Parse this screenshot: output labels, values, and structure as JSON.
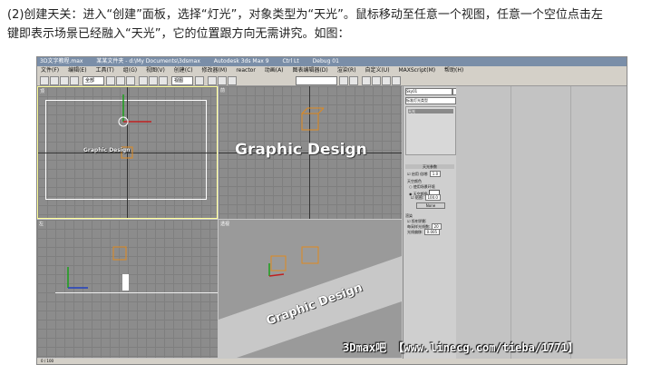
{
  "instruction": {
    "line1": "(2)创建天关：进入“创建”面板，选择“灯光”，对象类型为“天光”。鼠标移动至任意一个视图，任意一个空位点击左",
    "line2": "键即表示场景已经融入“天光”，它的位置跟方向无需讲究。如图："
  },
  "screenshot": {
    "titlebar": [
      "3D文字教程.max",
      "某某文件夹 - d:\\My Documents\\3dsmax",
      "Autodesk 3ds Max 9",
      "Ctrl Lt",
      "Debug 01"
    ],
    "menu": [
      "文件(F)",
      "编辑(E)",
      "工具(T)",
      "组(G)",
      "视图(V)",
      "创建(C)",
      "修改器(M)",
      "reactor",
      "动画(A)",
      "图表编辑器(D)",
      "渲染(R)",
      "自定义(U)",
      "MAXScript(M)",
      "帮助(H)"
    ],
    "toolbar_select_1": "全部",
    "toolbar_select_2": "视图",
    "viewport_labels": [
      "顶",
      "前",
      "左",
      "透视"
    ],
    "scene_text": "Graphic Design",
    "command_panel": {
      "name_field": "Sky01",
      "type_header": "标准灯光类型",
      "object_button": "天光",
      "rollout_params": "天光参数",
      "on_label": "启用",
      "multiplier_label": "倍增:",
      "multiplier_value": "1.0",
      "sky_color_label": "天空颜色",
      "use_env_label": "使用场景环境",
      "sky_color_opt": "天空颜色",
      "map_label": "贴图:",
      "map_value": "100.0",
      "none_label": "None",
      "render_header": "渲染",
      "cast_shadows": "投射阴影",
      "rays_label": "每采样光线数:",
      "rays_value": "20",
      "bias_label": "光线偏移:",
      "bias_value": "0.005"
    },
    "status_text": "0 / 100"
  },
  "watermark": "3Dmax吧 【www.linecg.com/tieba/1771】",
  "colors": {
    "viewport_bg": "#8c8c8c",
    "active_border": "#ffff99",
    "light_icon": "#e08a1e"
  }
}
